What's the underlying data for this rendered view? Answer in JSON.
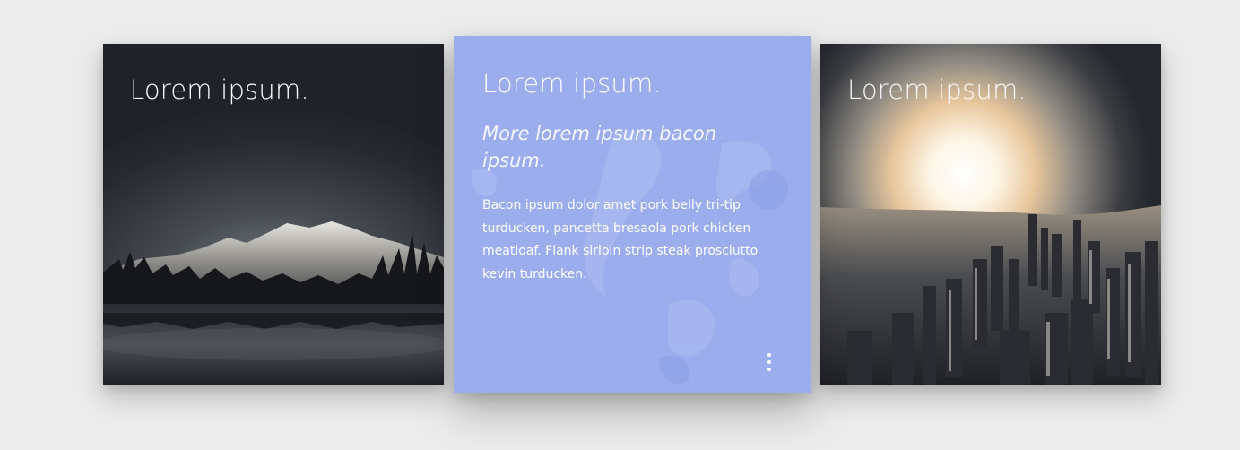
{
  "cards": [
    {
      "title": "Lorem ipsum.",
      "image": "mountain-lake-at-night"
    },
    {
      "title": "Lorem ipsum.",
      "subtitle": "More lorem ipsum bacon ipsum.",
      "body": "Bacon ipsum dolor amet pork belly tri-tip turducken, pancetta bresaola pork chicken meatloaf. Flank sirloin strip steak prosciutto kevin turducken.",
      "menu_icon": "more-vertical-icon",
      "accent_color": "#9cadee"
    },
    {
      "title": "Lorem ipsum.",
      "image": "city-skyline-at-sunrise"
    }
  ],
  "colors": {
    "page_background": "#ececec",
    "dark_card": "#1f2228",
    "accent_card": "#9cadee",
    "text": "#ffffff"
  }
}
